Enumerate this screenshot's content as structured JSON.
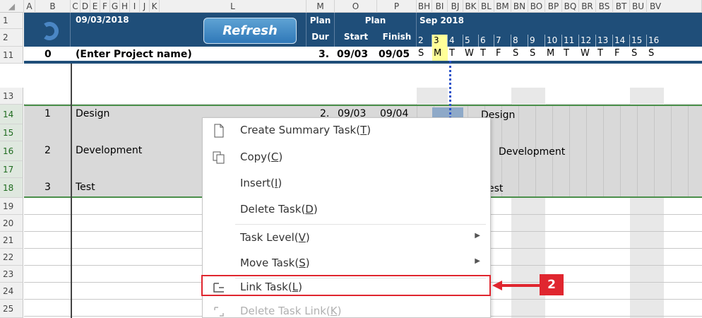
{
  "columns": [
    "A",
    "B",
    "C",
    "D",
    "E",
    "F",
    "G",
    "H",
    "I",
    "J",
    "K",
    "L",
    "M",
    "O",
    "P",
    "BH",
    "BI",
    "BJ",
    "BK",
    "BL",
    "BM",
    "BN",
    "BO",
    "BP",
    "BQ",
    "BR",
    "BS",
    "BT",
    "BU",
    "BV"
  ],
  "rows": [
    "1",
    "2",
    "11",
    "13",
    "14",
    "15",
    "16",
    "17",
    "18",
    "19",
    "20",
    "21",
    "22",
    "23",
    "24",
    "25"
  ],
  "header": {
    "date": "09/03/2018",
    "refresh_label": "Refresh",
    "plan_dur": [
      "Plan",
      "Dur"
    ],
    "plan_start": "Start",
    "plan_finish": "Finish",
    "plan_group": "Plan",
    "month": "Sep 2018",
    "days": [
      "2",
      "3",
      "4",
      "5",
      "6",
      "7",
      "8",
      "9",
      "10",
      "11",
      "12",
      "13",
      "14",
      "15",
      "16"
    ]
  },
  "weekdays": [
    "S",
    "M",
    "T",
    "W",
    "T",
    "F",
    "S",
    "S",
    "M",
    "T",
    "W",
    "T",
    "F",
    "S",
    "S"
  ],
  "project": {
    "id": "0",
    "name": "(Enter Project name)",
    "dur": "3.",
    "start": "09/03",
    "finish": "09/05"
  },
  "tasks": [
    {
      "id": "1",
      "name": "Design",
      "dur": "2.",
      "start": "09/03",
      "finish": "09/04",
      "bar_label": "Design"
    },
    {
      "id": "2",
      "name": "Development",
      "bar_label": "Development"
    },
    {
      "id": "3",
      "name": "Test",
      "bar_label": "est"
    }
  ],
  "context_menu": {
    "items": [
      {
        "label": "Create Summary Task",
        "key": "T",
        "icon": "document-icon"
      },
      {
        "label": "Copy",
        "key": "C",
        "icon": "copy-icon"
      },
      {
        "label": "Insert",
        "key": "I"
      },
      {
        "label": "Delete Task",
        "key": "D"
      },
      {
        "label": "Task Level",
        "key": "V",
        "submenu": true
      },
      {
        "label": "Move Task",
        "key": "S",
        "submenu": true
      },
      {
        "label": "Link Task",
        "key": "L",
        "icon": "link-task-icon"
      },
      {
        "label": "Delete Task Link",
        "key": "K",
        "icon": "unlink-icon",
        "disabled": true
      }
    ]
  },
  "callout": {
    "number": "2"
  },
  "colors": {
    "header": "#1f4e79",
    "highlight": "#e0262f",
    "today": "#ffff99"
  }
}
